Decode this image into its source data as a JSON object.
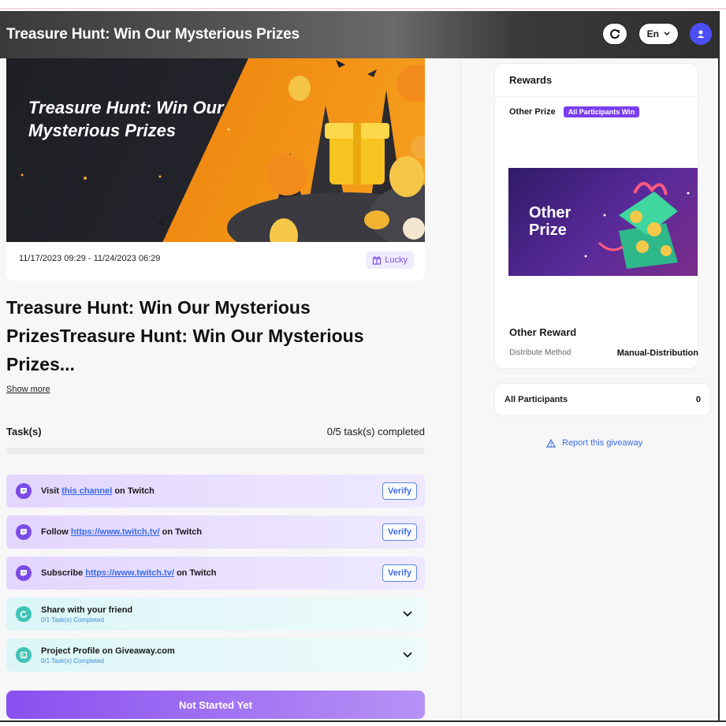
{
  "header": {
    "title": "Treasure Hunt: Win Our Mysterious Prizes",
    "lang": "En"
  },
  "banner": {
    "title": "Treasure Hunt: Win Our Mysterious Prizes",
    "date_range": "11/17/2023 09:29 - 11/24/2023 06:29",
    "badge": "Lucky"
  },
  "main": {
    "title": "Treasure Hunt: Win Our Mysterious PrizesTreasure Hunt: Win Our Mysterious Prizes...",
    "show_more": "Show more",
    "tasks_label": "Task(s)",
    "tasks_progress": "0/5 task(s) completed",
    "progress_fraction": 0,
    "cta": "Not Started Yet"
  },
  "tasks": [
    {
      "prefix": "Visit ",
      "link": "this channel",
      "suffix": " on Twitch",
      "action": "Verify"
    },
    {
      "prefix": "Follow ",
      "link": "https://www.twitch.tv/",
      "suffix": " on Twitch",
      "action": "Verify"
    },
    {
      "prefix": "Subscribe ",
      "link": "https://www.twitch.tv/",
      "suffix": " on Twitch",
      "action": "Verify"
    },
    {
      "title": "Share with your friend",
      "sub": "0/1 Task(s) Completed"
    },
    {
      "title": "Project Profile on Giveaway.com",
      "sub": "0/1 Task(s) Completed"
    }
  ],
  "rewards": {
    "heading": "Rewards",
    "prize_name": "Other Prize",
    "prize_badge": "All Participants Win",
    "image_text_1": "Other",
    "image_text_2": "Prize",
    "reward_name": "Other Reward",
    "dist_label": "Distribute Method",
    "dist_value": "Manual-Distribution"
  },
  "participants": {
    "label": "All Participants",
    "count": "0"
  },
  "report": "Report this giveaway",
  "colors": {
    "accent_purple": "#7b3df0",
    "link_blue": "#3b6ce8",
    "user_avatar": "#4c4ef5"
  }
}
